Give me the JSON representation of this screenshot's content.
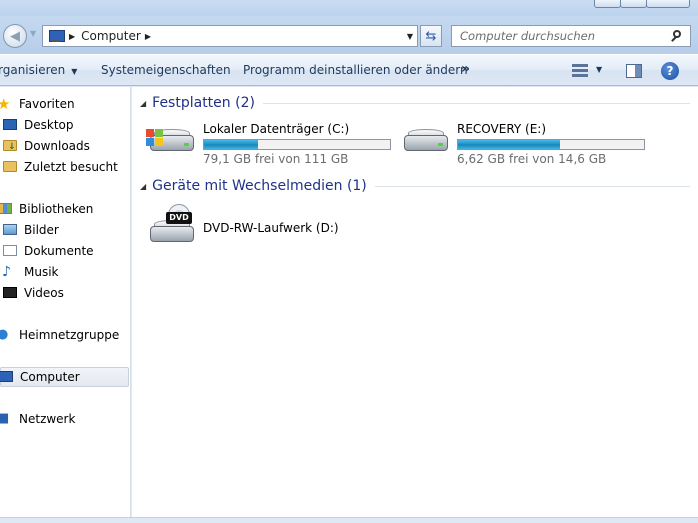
{
  "address": {
    "crumbs": [
      "Computer"
    ],
    "search_placeholder": "Computer durchsuchen"
  },
  "toolbar": {
    "organize": "rganisieren",
    "system_properties": "Systemeigenschaften",
    "uninstall": "Programm deinstallieren oder ändern",
    "more": "»"
  },
  "nav": {
    "favorites": "Favoriten",
    "desktop": "Desktop",
    "downloads": "Downloads",
    "recent": "Zuletzt besucht",
    "libraries": "Bibliotheken",
    "pictures": "Bilder",
    "documents": "Dokumente",
    "music": "Musik",
    "videos": "Videos",
    "homegroup": "Heimnetzgruppe",
    "computer": "Computer",
    "network": "Netzwerk"
  },
  "groups": {
    "hard_disks": "Festplatten (2)",
    "removable": "Geräte mit Wechselmedien (1)"
  },
  "drives": [
    {
      "name": "Lokaler Datenträger (C:)",
      "free_text": "79,1 GB frei von 111 GB",
      "used_fraction": 0.29
    },
    {
      "name": "RECOVERY (E:)",
      "free_text": "6,62 GB frei von 14,6 GB",
      "used_fraction": 0.55
    },
    {
      "name": "DVD-RW-Laufwerk (D:)"
    }
  ],
  "colors": {
    "accent": "#1e3287",
    "bar_fill": "#1e8fc4"
  }
}
